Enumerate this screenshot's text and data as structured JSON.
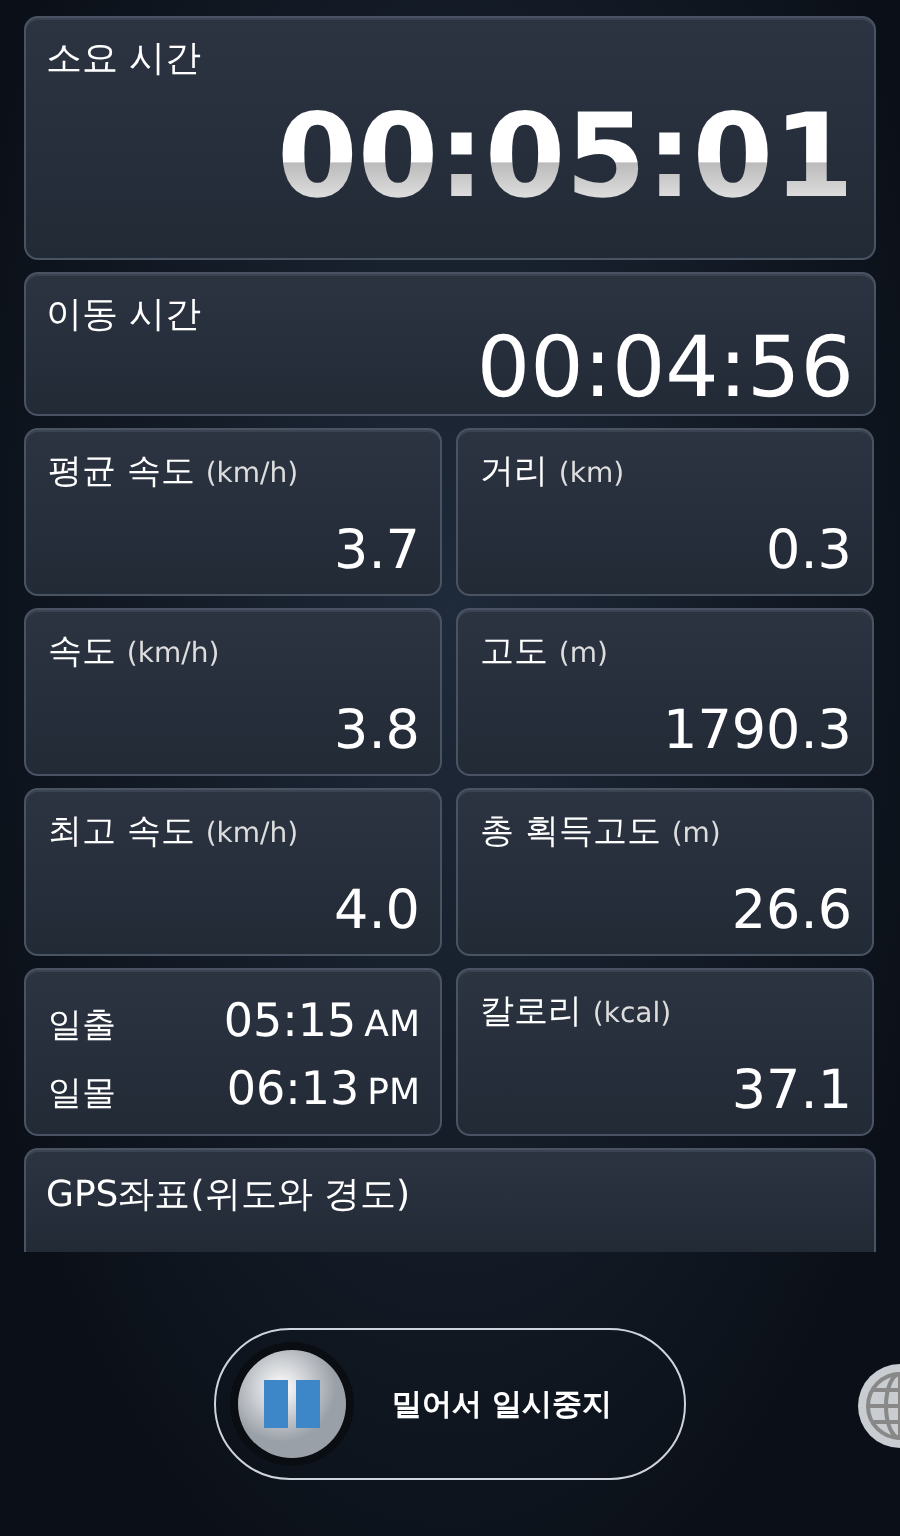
{
  "timers": [
    {
      "label": "소요 시간",
      "value": "00:05:01",
      "kind": "large"
    },
    {
      "label": "이동 시간",
      "value": "00:04:56",
      "kind": "medium"
    }
  ],
  "stats": [
    {
      "kind": "stat",
      "label": "평균 속도",
      "unit": "(km/h)",
      "value": "3.7"
    },
    {
      "kind": "stat",
      "label": "거리",
      "unit": "(km)",
      "value": "0.3"
    },
    {
      "kind": "stat",
      "label": "속도",
      "unit": "(km/h)",
      "value": "3.8"
    },
    {
      "kind": "stat",
      "label": "고도",
      "unit": "(m)",
      "value": "1790.3"
    },
    {
      "kind": "stat",
      "label": "최고 속도",
      "unit": "(km/h)",
      "value": "4.0"
    },
    {
      "kind": "stat",
      "label": "총 획득고도",
      "unit": "(m)",
      "value": "26.6"
    },
    {
      "kind": "sun",
      "rows": [
        {
          "label": "일출",
          "time": "05:15",
          "suffix": "AM"
        },
        {
          "label": "일몰",
          "time": "06:13",
          "suffix": "PM"
        }
      ]
    },
    {
      "kind": "stat",
      "label": "칼로리",
      "unit": "(kcal)",
      "value": "37.1"
    }
  ],
  "gps": {
    "label": "GPS좌표(위도와 경도)"
  },
  "pause_slider": {
    "label": "밀어서 일시중지"
  }
}
